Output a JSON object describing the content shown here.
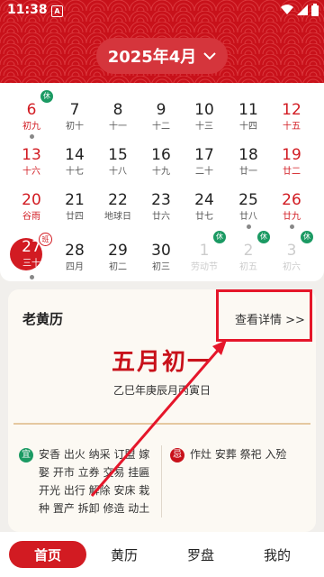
{
  "status_bar": {
    "time": "11:38",
    "a_icon": "A"
  },
  "header": {
    "month_label": "2025年4月"
  },
  "calendar": {
    "days": [
      {
        "num": "6",
        "lunar": "初九",
        "red": true,
        "badge": "休",
        "dot": true
      },
      {
        "num": "7",
        "lunar": "初十"
      },
      {
        "num": "8",
        "lunar": "十一"
      },
      {
        "num": "9",
        "lunar": "十二"
      },
      {
        "num": "10",
        "lunar": "十三"
      },
      {
        "num": "11",
        "lunar": "十四"
      },
      {
        "num": "12",
        "lunar": "十五",
        "red": true
      },
      {
        "num": "13",
        "lunar": "十六",
        "red": true
      },
      {
        "num": "14",
        "lunar": "十七"
      },
      {
        "num": "15",
        "lunar": "十八"
      },
      {
        "num": "16",
        "lunar": "十九"
      },
      {
        "num": "17",
        "lunar": "二十"
      },
      {
        "num": "18",
        "lunar": "廿一"
      },
      {
        "num": "19",
        "lunar": "廿二",
        "red": true
      },
      {
        "num": "20",
        "lunar": "谷雨",
        "red": true
      },
      {
        "num": "21",
        "lunar": "廿四"
      },
      {
        "num": "22",
        "lunar": "地球日"
      },
      {
        "num": "23",
        "lunar": "廿六"
      },
      {
        "num": "24",
        "lunar": "廿七"
      },
      {
        "num": "25",
        "lunar": "廿八",
        "dot": true
      },
      {
        "num": "26",
        "lunar": "廿九",
        "red": true,
        "dot": true
      },
      {
        "num": "27",
        "lunar": "三十",
        "today": true,
        "badge": "班",
        "dot": true
      },
      {
        "num": "28",
        "lunar": "四月"
      },
      {
        "num": "29",
        "lunar": "初二"
      },
      {
        "num": "30",
        "lunar": "初三"
      },
      {
        "num": "1",
        "lunar": "劳动节",
        "faded": true,
        "badge": "休"
      },
      {
        "num": "2",
        "lunar": "初五",
        "faded": true,
        "badge": "休"
      },
      {
        "num": "3",
        "lunar": "初六",
        "faded": true,
        "badge": "休"
      }
    ]
  },
  "almanac": {
    "title": "老黄历",
    "detail_link": "查看详情 >>",
    "big_date": "五月初一",
    "ganzhi": "乙巳年庚辰月丙寅日",
    "yi_label": "宜",
    "yi_lines": [
      "安香 出火 纳采 订盟 嫁",
      "娶 开市 立券 交易 挂匾",
      "开光 出行 解除 安床 栽",
      "种 置产 拆卸 修造 动土"
    ],
    "ji_label": "忌",
    "ji_text": "作灶 安葬 祭祀 入殓"
  },
  "nav": {
    "items": [
      "首页",
      "黄历",
      "罗盘",
      "我的"
    ]
  },
  "colors": {
    "brand_red": "#c8111a",
    "holiday_green": "#1b9a63",
    "annotation_red": "#e5162a"
  }
}
